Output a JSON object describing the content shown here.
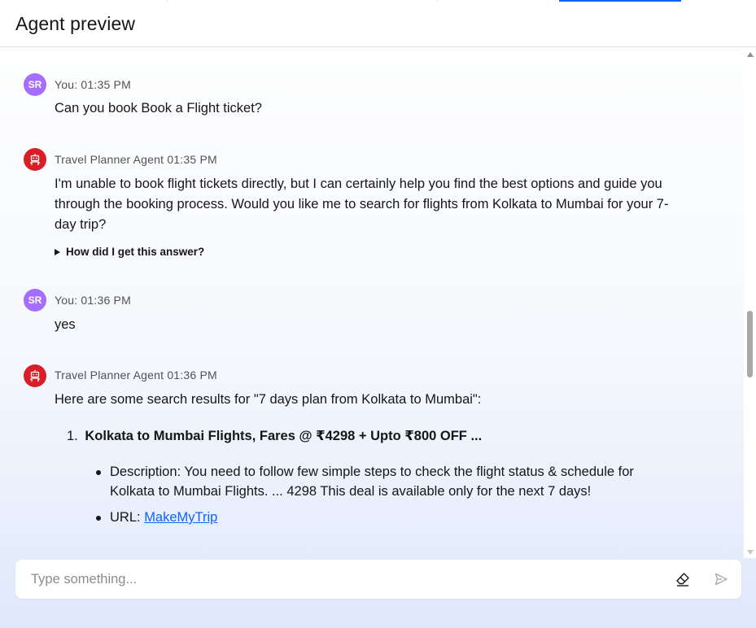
{
  "header": {
    "title": "Agent preview"
  },
  "messages": [
    {
      "avatar": "SR",
      "meta": "You: 01:35 PM",
      "text": "Can you book Book a Flight ticket?"
    },
    {
      "avatar": "robot-icon",
      "meta": "Travel Planner Agent 01:35 PM",
      "lines": [
        "I'm unable to book flight tickets directly, but I can certainly help you find the best options and guide you",
        "through the booking process. Would you like me to search for flights from Kolkata to Mumbai for your 7-",
        "day trip?"
      ],
      "details_label": "How did I get this answer?"
    },
    {
      "avatar": "SR",
      "meta": "You: 01:36 PM",
      "text": "yes"
    },
    {
      "avatar": "robot-icon",
      "meta": "Travel Planner Agent 01:36 PM",
      "intro": "Here are some search results for \"7 days plan from Kolkata to Mumbai\":",
      "result": {
        "number": "1.",
        "title": "Kolkata to Mumbai Flights, Fares @ ₹4298 + Upto ₹800 OFF ...",
        "description_label": "Description:",
        "description_lines": [
          "You need to follow few simple steps to check the flight status & schedule for",
          "Kolkata to Mumbai Flights. ... 4298 This deal is available only for the next 7 days!"
        ],
        "url_label": "URL:",
        "url_text": "MakeMyTrip"
      }
    }
  ],
  "input": {
    "placeholder": "Type something...",
    "value": ""
  },
  "icons": {
    "clear": "eraser-icon",
    "send": "send-icon"
  },
  "colors": {
    "user_avatar": "#a56eff",
    "agent_avatar": "#da1e28",
    "link": "#0f62fe"
  }
}
